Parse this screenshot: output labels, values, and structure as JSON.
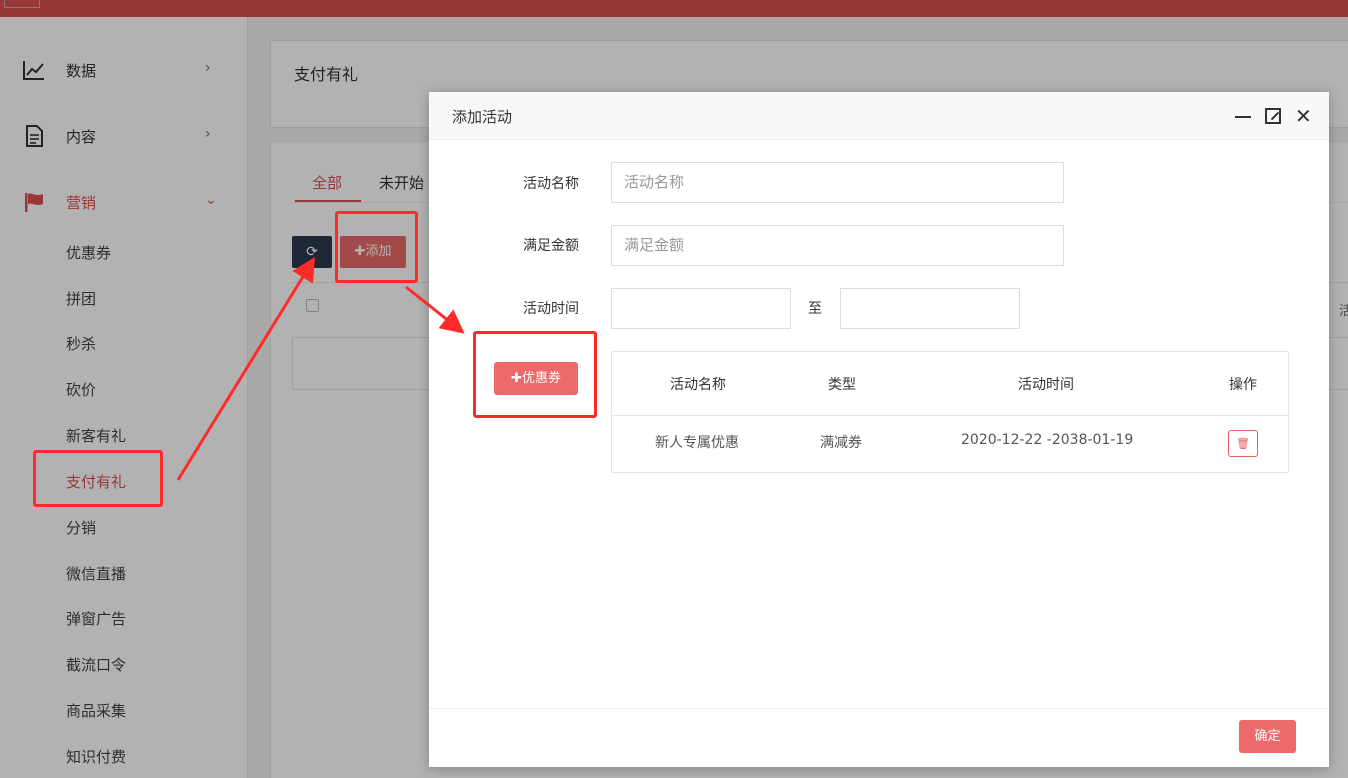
{
  "sidebar": {
    "groups": [
      {
        "label": "数据",
        "icon": "chart-line-icon"
      },
      {
        "label": "内容",
        "icon": "document-icon"
      },
      {
        "label": "营销",
        "icon": "flag-icon"
      }
    ],
    "marketing_items": [
      "优惠券",
      "拼团",
      "秒杀",
      "砍价",
      "新客有礼",
      "支付有礼",
      "分销",
      "微信直播",
      "弹窗广告",
      "截流口令",
      "商品采集",
      "知识付费"
    ],
    "active_item": "支付有礼"
  },
  "page": {
    "title": "支付有礼",
    "tabs": [
      "全部",
      "未开始"
    ],
    "add_label": "添加",
    "right_cut_text": "活"
  },
  "modal": {
    "title": "添加活动",
    "fields": {
      "name_label": "活动名称",
      "name_placeholder": "活动名称",
      "amount_label": "满足金额",
      "amount_placeholder": "满足金额",
      "time_label": "活动时间",
      "time_sep": "至",
      "time_start": "",
      "time_end": ""
    },
    "coupon_button": "优惠券",
    "table": {
      "headers": [
        "活动名称",
        "类型",
        "活动时间",
        "操作"
      ],
      "rows": [
        {
          "name": "新人专属优惠",
          "type": "满减券",
          "time": "2020-12-22 -2038-01-19"
        }
      ]
    },
    "confirm_label": "确定"
  },
  "colors": {
    "brand_red": "#d94f4f",
    "button_red": "#ee6a6a",
    "annotation_red": "#ff2a2a"
  }
}
